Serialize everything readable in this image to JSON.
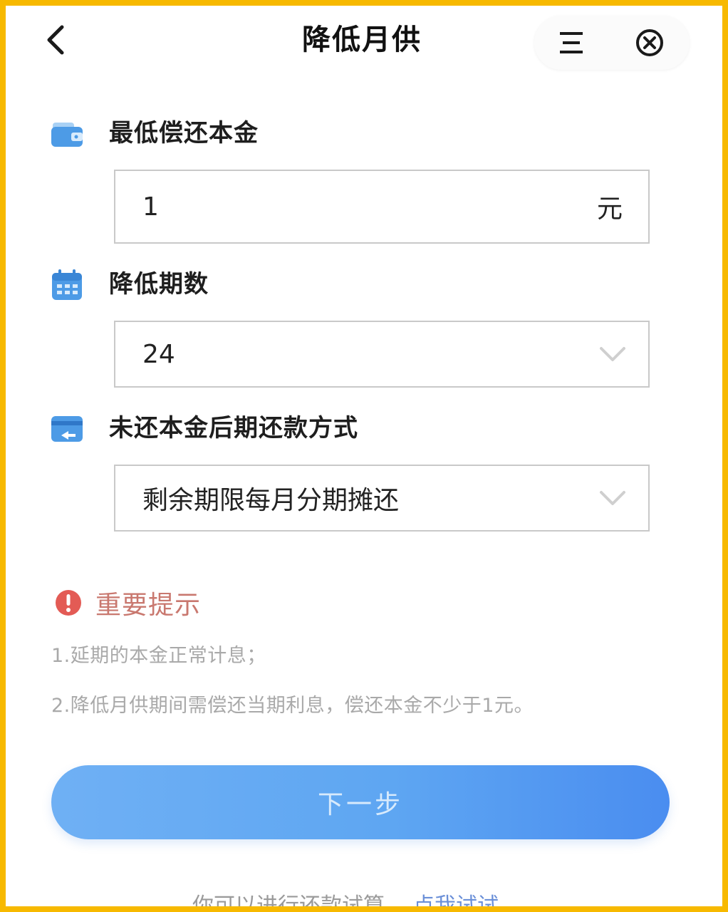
{
  "header": {
    "title": "降低月供",
    "back_icon": "chevron-left-icon",
    "menu_icon": "menu-icon",
    "close_icon": "close-circle-icon"
  },
  "form": {
    "principal": {
      "label": "最低偿还本金",
      "icon": "wallet-icon",
      "value": "1",
      "unit": "元"
    },
    "periods": {
      "label": "降低期数",
      "icon": "calendar-icon",
      "value": "24"
    },
    "repay_method": {
      "label": "未还本金后期还款方式",
      "icon": "card-return-icon",
      "value": "剩余期限每月分期摊还"
    }
  },
  "notice": {
    "title": "重要提示",
    "lines": [
      "1.延期的本金正常计息；",
      "2.降低月供期间需偿还当期利息，偿还本金不少于1元。"
    ]
  },
  "actions": {
    "next_label": "下一步"
  },
  "footer": {
    "text": "你可以进行还款试算",
    "link": "点我试试"
  },
  "colors": {
    "frame": "#f7b900",
    "primary": "#5ea6f2",
    "icon_blue": "#4d9be6",
    "notice_red": "#e35b55"
  }
}
